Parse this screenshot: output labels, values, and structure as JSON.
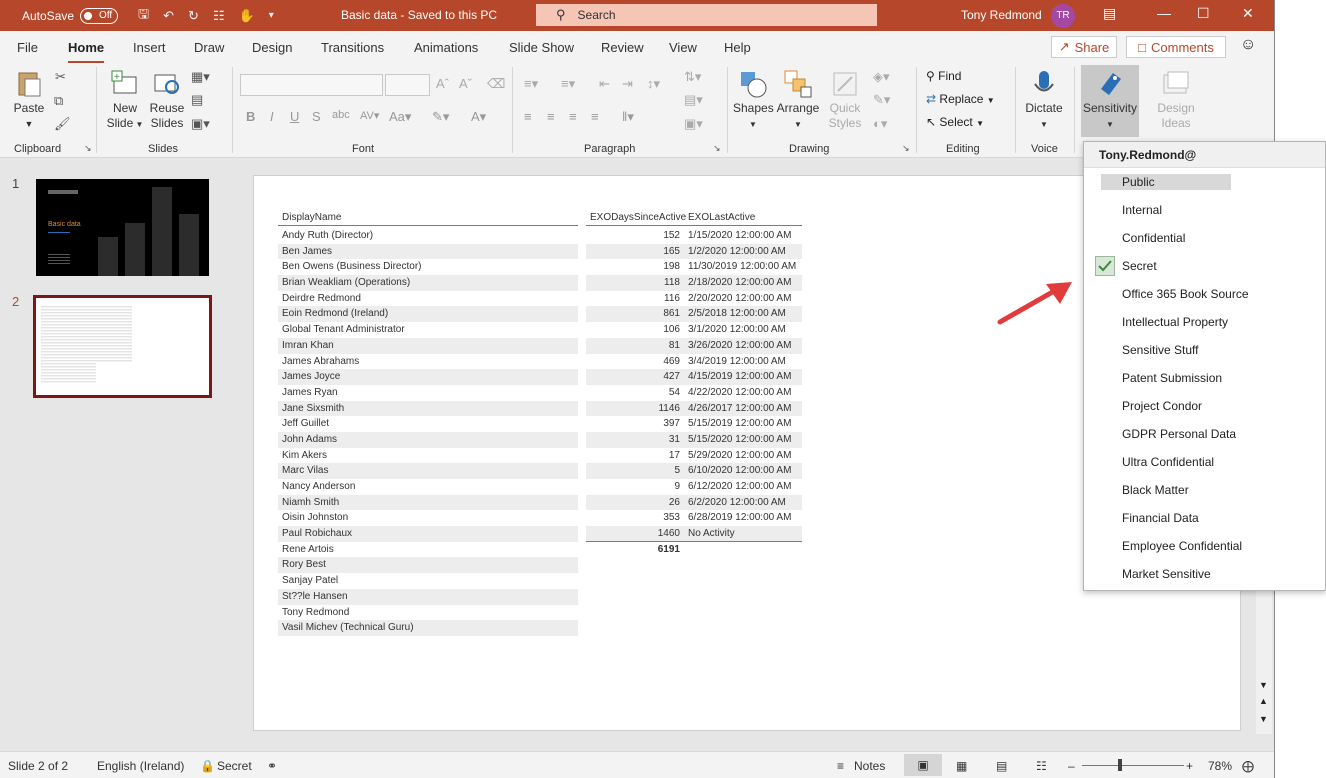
{
  "titlebar": {
    "autosave": "AutoSave",
    "autosave_state": "Off",
    "doc_title": "Basic data  -  Saved to this PC",
    "search": "Search",
    "user": "Tony Redmond",
    "initials": "TR"
  },
  "tabs": [
    "File",
    "Home",
    "Insert",
    "Draw",
    "Design",
    "Transitions",
    "Animations",
    "Slide Show",
    "Review",
    "View",
    "Help"
  ],
  "share": "Share",
  "comments": "Comments",
  "ribbon": {
    "paste": "Paste",
    "new_slide": [
      "New",
      "Slide"
    ],
    "reuse_slides": [
      "Reuse",
      "Slides"
    ],
    "shapes": "Shapes",
    "arrange": "Arrange",
    "quick_styles": [
      "Quick",
      "Styles"
    ],
    "find": "Find",
    "replace": "Replace",
    "select": "Select",
    "dictate": "Dictate",
    "sensitivity": "Sensitivity",
    "design_ideas": [
      "Design",
      "Ideas"
    ],
    "groups": [
      "Clipboard",
      "Slides",
      "Font",
      "Paragraph",
      "Drawing",
      "Editing",
      "Voice"
    ]
  },
  "thumbnails": {
    "slide1_num": "1",
    "slide2_num": "2",
    "slide1_title": "Basic data"
  },
  "table": {
    "headers": [
      "DisplayName",
      "EXODaysSinceActive",
      "EXOLastActive"
    ],
    "names": [
      "Andy Ruth (Director)",
      "Ben James",
      "Ben Owens (Business Director)",
      "Brian Weakliam (Operations)",
      "Deirdre Redmond",
      "Eoin Redmond (Ireland)",
      "Global Tenant Administrator",
      "Imran Khan",
      "James Abrahams",
      "James Joyce",
      "James Ryan",
      "Jane Sixsmith",
      "Jeff Guillet",
      "John Adams",
      "Kim Akers",
      "Marc Vilas",
      "Nancy Anderson",
      "Niamh Smith",
      "Oisin Johnston",
      "Paul Robichaux",
      "Rene Artois",
      "Rory Best",
      "Sanjay Patel",
      "St??le Hansen",
      "Tony Redmond",
      "Vasil Michev (Technical Guru)"
    ],
    "days": [
      "152",
      "165",
      "198",
      "118",
      "116",
      "861",
      "106",
      "81",
      "469",
      "427",
      "54",
      "1146",
      "397",
      "31",
      "17",
      "5",
      "9",
      "26",
      "353",
      "1460"
    ],
    "last_active": [
      "1/15/2020 12:00:00 AM",
      "1/2/2020 12:00:00 AM",
      "11/30/2019 12:00:00 AM",
      "2/18/2020 12:00:00 AM",
      "2/20/2020 12:00:00 AM",
      "2/5/2018 12:00:00 AM",
      "3/1/2020 12:00:00 AM",
      "3/26/2020 12:00:00 AM",
      "3/4/2019 12:00:00 AM",
      "4/15/2019 12:00:00 AM",
      "4/22/2020 12:00:00 AM",
      "4/26/2017 12:00:00 AM",
      "5/15/2019 12:00:00 AM",
      "5/15/2020 12:00:00 AM",
      "5/29/2020 12:00:00 AM",
      "6/10/2020 12:00:00 AM",
      "6/12/2020 12:00:00 AM",
      "6/2/2020 12:00:00 AM",
      "6/28/2019 12:00:00 AM",
      "No Activity"
    ],
    "total": "6191"
  },
  "sensitivity_menu": {
    "account": "Tony.Redmond@",
    "items": [
      "Public",
      "Internal",
      "Confidential",
      "Secret",
      "Office 365 Book Source",
      "Intellectual Property",
      "Sensitive Stuff",
      "Patent Submission",
      "Project Condor",
      "GDPR Personal Data",
      "Ultra Confidential",
      "Black Matter",
      "Financial Data",
      "Employee Confidential",
      "Market Sensitive"
    ],
    "checked_index": 3,
    "accent_color": "#b7472a"
  },
  "statusbar": {
    "slide": "Slide 2 of 2",
    "language": "English (Ireland)",
    "label": "Secret",
    "notes": "Notes",
    "zoom": "78%"
  }
}
